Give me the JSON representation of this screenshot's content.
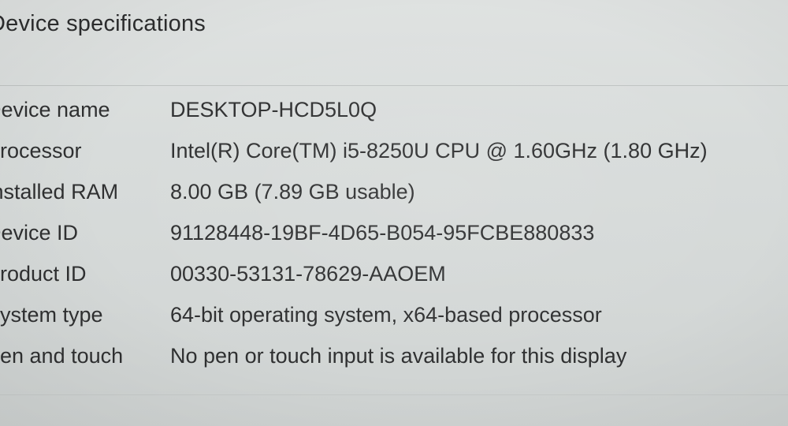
{
  "section": {
    "title": "Device specifications"
  },
  "specs": [
    {
      "label": "Device name",
      "value": "DESKTOP-HCD5L0Q"
    },
    {
      "label": "Processor",
      "value": "Intel(R) Core(TM) i5-8250U CPU @ 1.60GHz (1.80 GHz)"
    },
    {
      "label": "Installed RAM",
      "value": "8.00 GB (7.89 GB usable)"
    },
    {
      "label": "Device ID",
      "value": "91128448-19BF-4D65-B054-95FCBE880833"
    },
    {
      "label": "Product ID",
      "value": "00330-53131-78629-AAOEM"
    },
    {
      "label": "System type",
      "value": "64-bit operating system, x64-based processor"
    },
    {
      "label": "Pen and touch",
      "value": "No pen or touch input is available for this display"
    }
  ]
}
